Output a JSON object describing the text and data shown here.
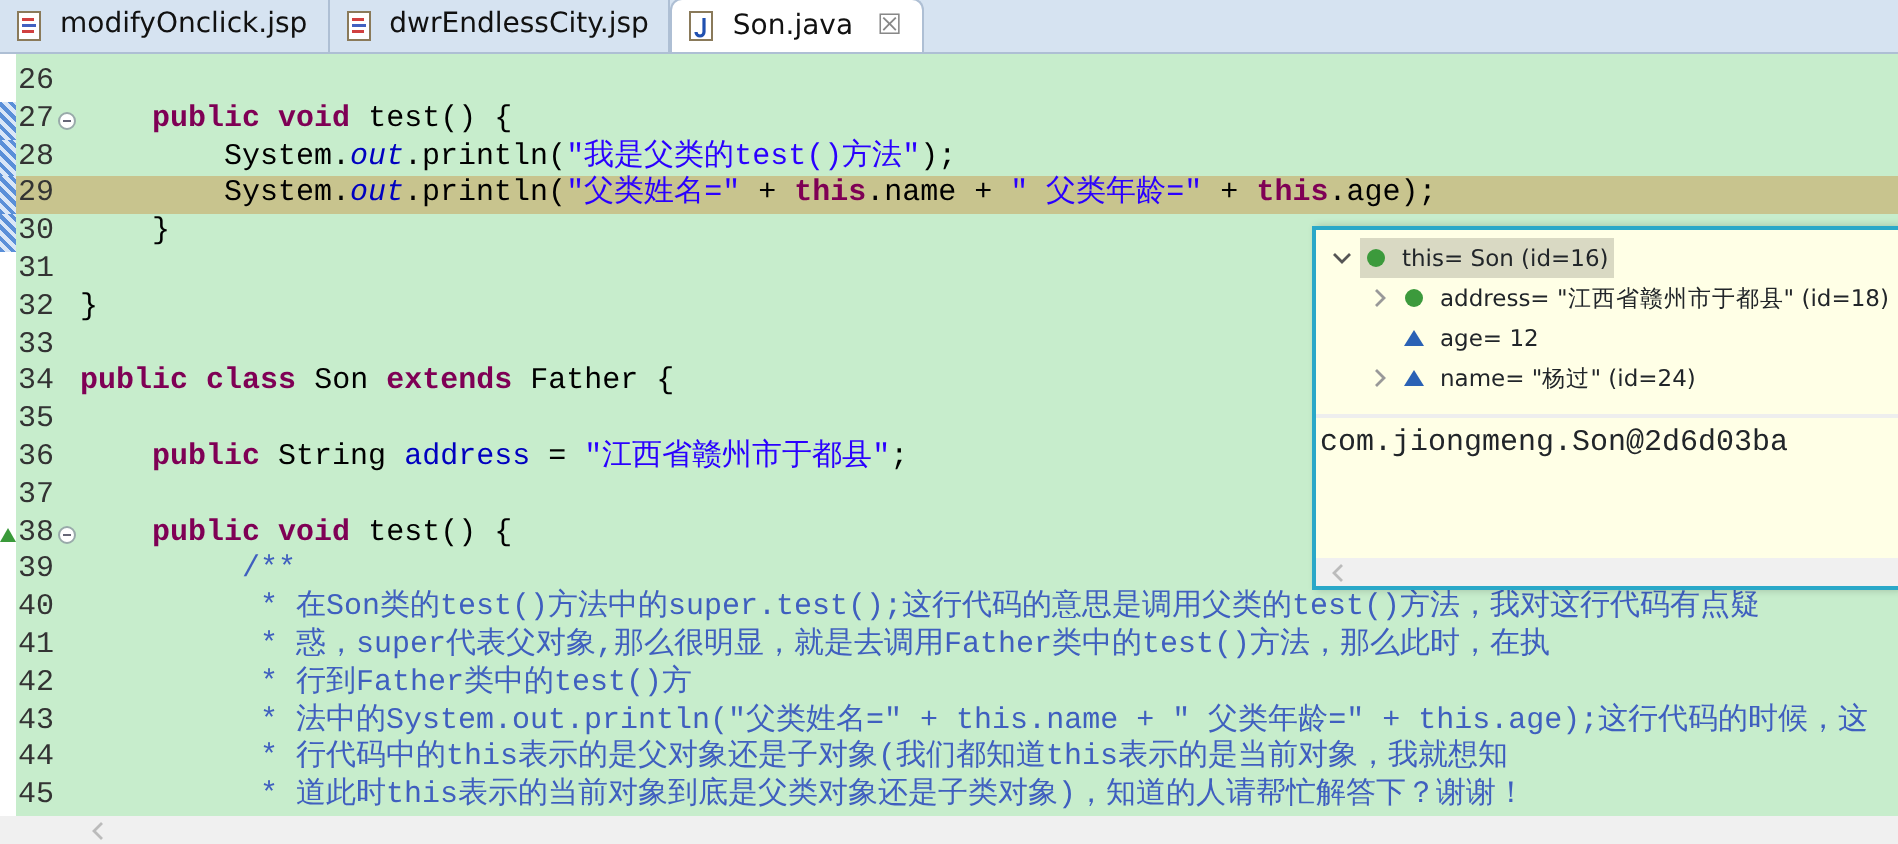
{
  "tabs": [
    {
      "label": "modifyOnclick.jsp",
      "kind": "jsp",
      "selected": false
    },
    {
      "label": "dwrEndlessCity.jsp",
      "kind": "jsp",
      "selected": false
    },
    {
      "label": "Son.java",
      "kind": "java",
      "selected": true,
      "close": "☒"
    }
  ],
  "editor": {
    "lines": [
      {
        "number": "26",
        "current": false,
        "range": false,
        "foldable": false,
        "overrides": false
      },
      {
        "number": "27",
        "current": false,
        "range": true,
        "foldable": true,
        "overrides": false,
        "tokens": [
          {
            "kind": "keyword",
            "text": "    public"
          },
          {
            "kind": "keyword",
            "text": " void"
          },
          {
            "kind": "plain",
            "text": " test() {"
          }
        ]
      },
      {
        "number": "28",
        "current": false,
        "range": true,
        "foldable": false,
        "overrides": false,
        "tokens": [
          {
            "kind": "plain",
            "text": "        System."
          },
          {
            "kind": "static",
            "text": "out"
          },
          {
            "kind": "plain",
            "text": ".println("
          },
          {
            "kind": "string",
            "text": "\"我是父类的test()方法\""
          },
          {
            "kind": "plain",
            "text": ");"
          }
        ]
      },
      {
        "number": "29",
        "current": true,
        "range": true,
        "foldable": false,
        "overrides": false,
        "tokens": [
          {
            "kind": "plain",
            "text": "        System."
          },
          {
            "kind": "static",
            "text": "out"
          },
          {
            "kind": "plain",
            "text": ".println("
          },
          {
            "kind": "string",
            "text": "\"父类姓名=\""
          },
          {
            "kind": "plain",
            "text": " + "
          },
          {
            "kind": "keyword",
            "text": "this"
          },
          {
            "kind": "plain",
            "text": ".name + "
          },
          {
            "kind": "string",
            "text": "\" 父类年龄=\""
          },
          {
            "kind": "plain",
            "text": " + "
          },
          {
            "kind": "keyword",
            "text": "this"
          },
          {
            "kind": "plain",
            "text": ".age);"
          }
        ]
      },
      {
        "number": "30",
        "current": false,
        "range": true,
        "foldable": false,
        "overrides": false,
        "tokens": [
          {
            "kind": "plain",
            "text": "    }"
          }
        ]
      },
      {
        "number": "31",
        "current": false,
        "range": false,
        "foldable": false,
        "overrides": false
      },
      {
        "number": "32",
        "current": false,
        "range": false,
        "foldable": false,
        "overrides": false,
        "tokens": [
          {
            "kind": "plain",
            "text": "}"
          }
        ]
      },
      {
        "number": "33",
        "current": false,
        "range": false,
        "foldable": false,
        "overrides": false
      },
      {
        "number": "34",
        "current": false,
        "range": false,
        "foldable": false,
        "overrides": false,
        "tokens": [
          {
            "kind": "keyword",
            "text": "public"
          },
          {
            "kind": "keyword",
            "text": " class"
          },
          {
            "kind": "plain",
            "text": " Son "
          },
          {
            "kind": "keyword",
            "text": "extends"
          },
          {
            "kind": "plain",
            "text": " Father {"
          }
        ]
      },
      {
        "number": "35",
        "current": false,
        "range": false,
        "foldable": false,
        "overrides": false
      },
      {
        "number": "36",
        "current": false,
        "range": false,
        "foldable": false,
        "overrides": false,
        "tokens": [
          {
            "kind": "keyword",
            "text": "    public"
          },
          {
            "kind": "plain",
            "text": " String "
          },
          {
            "kind": "field",
            "text": "address"
          },
          {
            "kind": "plain",
            "text": " = "
          },
          {
            "kind": "string",
            "text": "\"江西省赣州市于都县\""
          },
          {
            "kind": "plain",
            "text": ";"
          }
        ]
      },
      {
        "number": "37",
        "current": false,
        "range": false,
        "foldable": false,
        "overrides": false
      },
      {
        "number": "38",
        "current": false,
        "range": false,
        "foldable": true,
        "overrides": true,
        "tokens": [
          {
            "kind": "keyword",
            "text": "    public"
          },
          {
            "kind": "keyword",
            "text": " void"
          },
          {
            "kind": "plain",
            "text": " test() {"
          }
        ]
      },
      {
        "number": "39",
        "current": false,
        "range": false,
        "foldable": false,
        "overrides": false,
        "tokens": [
          {
            "kind": "comment",
            "text": "         /**"
          }
        ]
      },
      {
        "number": "40",
        "current": false,
        "range": false,
        "foldable": false,
        "overrides": false,
        "tokens": [
          {
            "kind": "comment",
            "text": "          * 在Son类的test()方法中的super.test();这行代码的意思是调用父类的test()方法，我对这行代码有点疑"
          }
        ]
      },
      {
        "number": "41",
        "current": false,
        "range": false,
        "foldable": false,
        "overrides": false,
        "tokens": [
          {
            "kind": "comment",
            "text": "          * 惑，super代表父对象,那么很明显，就是去调用Father类中的test()方法，那么此时，在执"
          }
        ]
      },
      {
        "number": "42",
        "current": false,
        "range": false,
        "foldable": false,
        "overrides": false,
        "tokens": [
          {
            "kind": "comment",
            "text": "          * 行到Father类中的test()方"
          }
        ]
      },
      {
        "number": "43",
        "current": false,
        "range": false,
        "foldable": false,
        "overrides": false,
        "tokens": [
          {
            "kind": "comment",
            "text": "          * 法中的System.out.println(\"父类姓名=\" + this.name + \" 父类年龄=\" + this.age);这行代码的时候，这"
          }
        ]
      },
      {
        "number": "44",
        "current": false,
        "range": false,
        "foldable": false,
        "overrides": false,
        "tokens": [
          {
            "kind": "comment",
            "text": "          * 行代码中的this表示的是父对象还是子对象(我们都知道this表示的是当前对象，我就想知"
          }
        ]
      },
      {
        "number": "45",
        "current": false,
        "range": false,
        "foldable": false,
        "overrides": false,
        "tokens": [
          {
            "kind": "comment",
            "text": "          * 道此时this表示的当前对象到底是父类对象还是子类对象)，知道的人请帮忙解答下？谢谢！"
          }
        ]
      }
    ]
  },
  "debug_popup": {
    "tree": [
      {
        "label": "this= Son  (id=16)",
        "kind": "public",
        "has_children": true,
        "expanded": true,
        "selected": true,
        "children": [
          {
            "label": "address= \"江西省赣州市于都县\" (id=18)",
            "kind": "public",
            "has_children": true,
            "expanded": false,
            "selected": false
          },
          {
            "label": "age= 12",
            "kind": "default",
            "has_children": false,
            "expanded": false,
            "selected": false
          },
          {
            "label": "name= \"杨过\" (id=24)",
            "kind": "default",
            "has_children": true,
            "expanded": false,
            "selected": false
          }
        ]
      }
    ],
    "value_text": "com.jiongmeng.Son@2d6d03ba"
  }
}
